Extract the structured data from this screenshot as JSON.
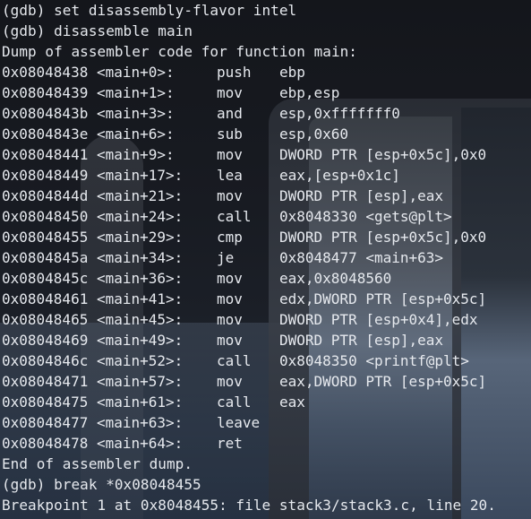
{
  "terminal": {
    "lines_before": [
      "(gdb) set disassembly-flavor intel",
      "(gdb) disassemble main",
      "Dump of assembler code for function main:"
    ],
    "asm": [
      {
        "addr": "0x08048438 <main+0>:",
        "mnem": "push",
        "ops": "ebp"
      },
      {
        "addr": "0x08048439 <main+1>:",
        "mnem": "mov",
        "ops": "ebp,esp"
      },
      {
        "addr": "0x0804843b <main+3>:",
        "mnem": "and",
        "ops": "esp,0xfffffff0"
      },
      {
        "addr": "0x0804843e <main+6>:",
        "mnem": "sub",
        "ops": "esp,0x60"
      },
      {
        "addr": "0x08048441 <main+9>:",
        "mnem": "mov",
        "ops": "DWORD PTR [esp+0x5c],0x0"
      },
      {
        "addr": "0x08048449 <main+17>:",
        "mnem": "lea",
        "ops": "eax,[esp+0x1c]"
      },
      {
        "addr": "0x0804844d <main+21>:",
        "mnem": "mov",
        "ops": "DWORD PTR [esp],eax"
      },
      {
        "addr": "0x08048450 <main+24>:",
        "mnem": "call",
        "ops": "0x8048330 <gets@plt>"
      },
      {
        "addr": "0x08048455 <main+29>:",
        "mnem": "cmp",
        "ops": "DWORD PTR [esp+0x5c],0x0"
      },
      {
        "addr": "0x0804845a <main+34>:",
        "mnem": "je",
        "ops": "0x8048477 <main+63>"
      },
      {
        "addr": "0x0804845c <main+36>:",
        "mnem": "mov",
        "ops": "eax,0x8048560"
      },
      {
        "addr": "0x08048461 <main+41>:",
        "mnem": "mov",
        "ops": "edx,DWORD PTR [esp+0x5c]"
      },
      {
        "addr": "0x08048465 <main+45>:",
        "mnem": "mov",
        "ops": "DWORD PTR [esp+0x4],edx"
      },
      {
        "addr": "0x08048469 <main+49>:",
        "mnem": "mov",
        "ops": "DWORD PTR [esp],eax"
      },
      {
        "addr": "0x0804846c <main+52>:",
        "mnem": "call",
        "ops": "0x8048350 <printf@plt>"
      },
      {
        "addr": "0x08048471 <main+57>:",
        "mnem": "mov",
        "ops": "eax,DWORD PTR [esp+0x5c]"
      },
      {
        "addr": "0x08048475 <main+61>:",
        "mnem": "call",
        "ops": "eax"
      },
      {
        "addr": "0x08048477 <main+63>:",
        "mnem": "leave",
        "ops": ""
      },
      {
        "addr": "0x08048478 <main+64>:",
        "mnem": "ret",
        "ops": ""
      }
    ],
    "lines_after": [
      "End of assembler dump.",
      "(gdb) break *0x08048455",
      "Breakpoint 1 at 0x8048455: file stack3/stack3.c, line 20."
    ]
  },
  "colors": {
    "text": "#e6e9ee",
    "background": "#181b22"
  }
}
